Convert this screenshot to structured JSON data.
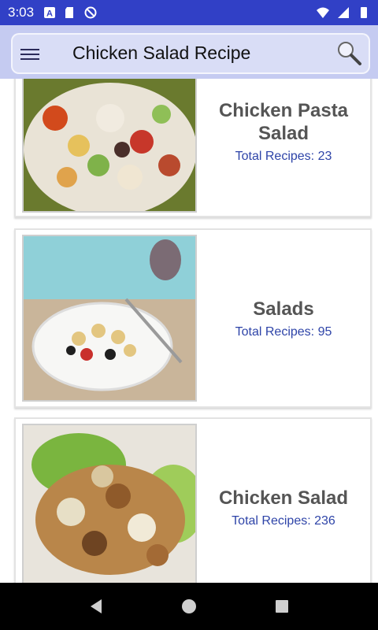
{
  "status_bar": {
    "time": "3:03",
    "background_color": "#3140c6",
    "left_icons": [
      "a-letter-icon",
      "sd-card-icon",
      "at-sign-icon"
    ],
    "right_icons": [
      "wifi-icon",
      "cell-signal-icon",
      "battery-icon"
    ]
  },
  "app_bar": {
    "title": "Chicken Salad Recipe",
    "menu_icon": "hamburger-menu-icon",
    "search_icon": "search-icon"
  },
  "categories": [
    {
      "title": "Chicken Pasta Salad",
      "subtitle": "Total Recipes: 23",
      "image": "pasta-salad-photo"
    },
    {
      "title": "Salads",
      "subtitle": "Total Recipes: 95",
      "image": "salad-plate-photo"
    },
    {
      "title": "Chicken Salad",
      "subtitle": "Total Recipes: 236",
      "image": "chicken-salad-photo"
    }
  ],
  "nav_bar": {
    "buttons": [
      "back-icon",
      "home-icon",
      "recents-icon"
    ]
  },
  "colors": {
    "accent": "#2e44a8",
    "title_text": "#555555"
  }
}
